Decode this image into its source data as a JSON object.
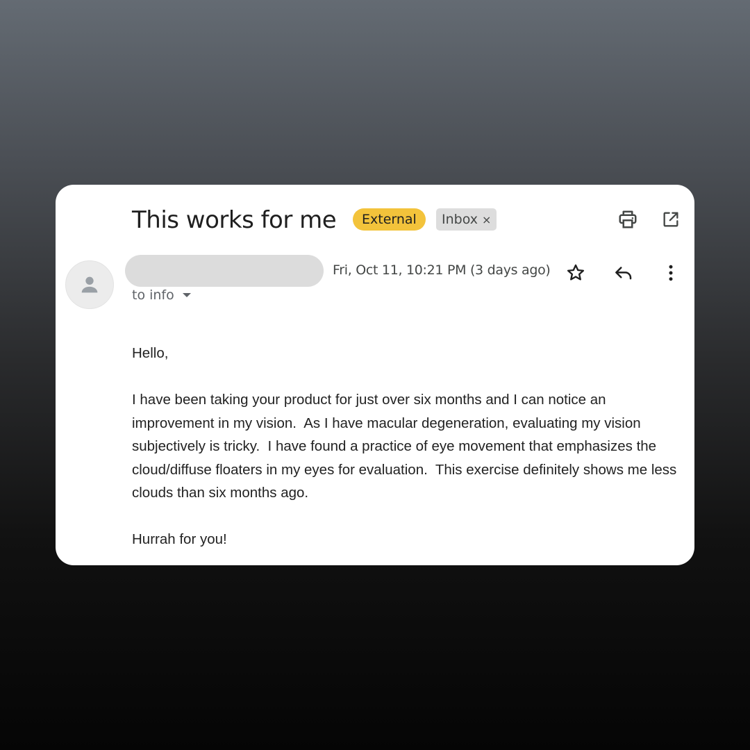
{
  "email": {
    "subject": "This works for me",
    "labels": {
      "external": "External",
      "inbox": "Inbox",
      "remove_glyph": "×"
    },
    "sender": {
      "name_redacted": true,
      "avatar_icon": "person-icon"
    },
    "date": "Fri, Oct 11, 10:21 PM (3 days ago)",
    "recipient_text": "to info",
    "body": {
      "greeting": "Hello,",
      "paragraph": "I have been taking your product for just over six months and I can notice an improvement in my vision.  As I have macular degeneration, evaluating my vision subjectively is tricky.  I have found a practice of eye movement that emphasizes the cloud/diffuse floaters in my eyes for evaluation.  This exercise definitely shows me less clouds than six months ago.",
      "closing": "Hurrah for you!"
    }
  },
  "toolbar": {
    "icons": [
      "print-icon",
      "open-in-new-window-icon",
      "star-icon",
      "reply-icon",
      "more-options-icon"
    ]
  },
  "colors": {
    "external_badge": "#f3c33b",
    "inbox_badge": "#dddddd",
    "card_background": "#ffffff"
  }
}
